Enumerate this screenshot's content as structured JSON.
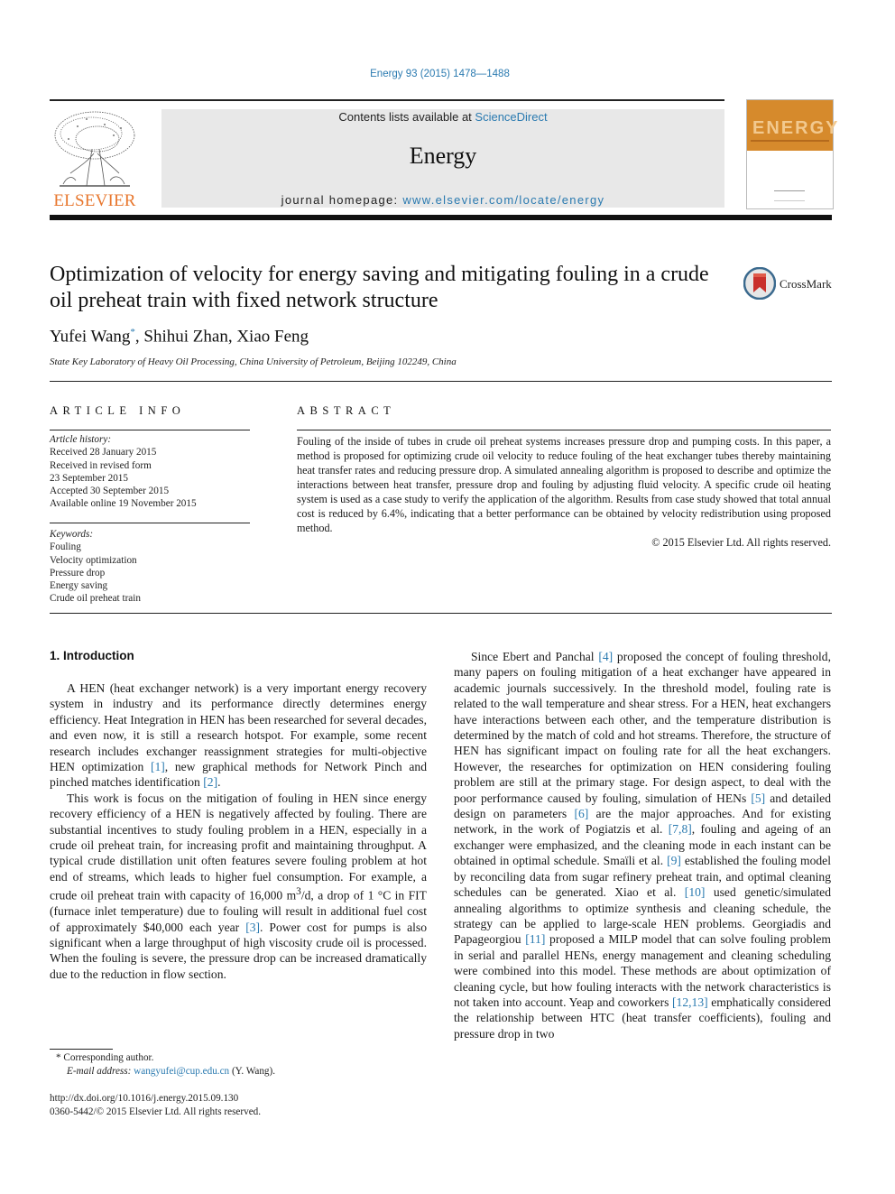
{
  "header": {
    "citation": "Energy 93 (2015) 1478—1488",
    "contents_prefix": "Contents lists available at ",
    "contents_link": "ScienceDirect",
    "journal_name": "Energy",
    "homepage_prefix": "journal homepage: ",
    "homepage_link": "www.elsevier.com/locate/energy",
    "publisher_logo_text": "ELSEVIER",
    "cover_title": "ENERGY"
  },
  "article": {
    "title": "Optimization of velocity for energy saving and mitigating fouling in a crude oil preheat train with fixed network structure",
    "crossmark_label": "CrossMark",
    "authors": [
      {
        "name": "Yufei Wang",
        "mark": "*"
      },
      {
        "name": "Shihui Zhan"
      },
      {
        "name": "Xiao Feng"
      }
    ],
    "author_sep": ", ",
    "affiliation": "State Key Laboratory of Heavy Oil Processing, China University of Petroleum, Beijing 102249, China"
  },
  "article_info": {
    "heading": "ARTICLE INFO",
    "history_label": "Article history:",
    "history": [
      "Received 28 January 2015",
      "Received in revised form",
      "23 September 2015",
      "Accepted 30 September 2015",
      "Available online 19 November 2015"
    ],
    "keywords_label": "Keywords:",
    "keywords": [
      "Fouling",
      "Velocity optimization",
      "Pressure drop",
      "Energy saving",
      "Crude oil preheat train"
    ]
  },
  "abstract": {
    "heading": "ABSTRACT",
    "text": "Fouling of the inside of tubes in crude oil preheat systems increases pressure drop and pumping costs. In this paper, a method is proposed for optimizing crude oil velocity to reduce fouling of the heat exchanger tubes thereby maintaining heat transfer rates and reducing pressure drop. A simulated annealing algorithm is proposed to describe and optimize the interactions between heat transfer, pressure drop and fouling by adjusting fluid velocity. A specific crude oil heating system is used as a case study to verify the application of the algorithm. Results from case study showed that total annual cost is reduced by 6.4%, indicating that a better performance can be obtained by velocity redistribution using proposed method.",
    "copyright": "© 2015 Elsevier Ltd. All rights reserved."
  },
  "intro": {
    "heading": "1.  Introduction",
    "p1": [
      {
        "t": "A HEN (heat exchanger network) is a very important energy recovery system in industry and its performance directly determines energy efficiency. Heat Integration in HEN has been researched for several decades, and even now, it is still a research hotspot. For example, some recent research includes exchanger reassignment strategies for multi-objective HEN optimization "
      },
      {
        "ref": "[1]"
      },
      {
        "t": ", new graphical methods for Network Pinch and pinched matches identification "
      },
      {
        "ref": "[2]"
      },
      {
        "t": "."
      }
    ],
    "p2": [
      {
        "t": "This work is focus on the mitigation of fouling in HEN since energy recovery efficiency of a HEN is negatively affected by fouling. There are substantial incentives to study fouling problem in a HEN, especially in a crude oil preheat train, for increasing profit and maintaining throughput. A typical crude distillation unit often features severe fouling problem at hot end of streams, which leads to higher fuel consumption. For example, a crude oil preheat train with capacity of 16,000 m"
      },
      {
        "sup": "3"
      },
      {
        "t": "/d, a drop of 1 °C in FIT (furnace inlet temperature) due to fouling will result in additional fuel cost of approximately $40,000 each year "
      },
      {
        "ref": "[3]"
      },
      {
        "t": ". Power cost for pumps is also significant when a large throughput of high viscosity crude oil is processed. When the fouling is severe, the pressure drop can be increased dramatically due to the reduction in flow section."
      }
    ],
    "p3": [
      {
        "t": "Since Ebert and Panchal "
      },
      {
        "ref": "[4]"
      },
      {
        "t": " proposed the concept of fouling threshold, many papers on fouling mitigation of a heat exchanger have appeared in academic journals successively. In the threshold model, fouling rate is related to the wall temperature and shear stress. For a HEN, heat exchangers have interactions between each other, and the temperature distribution is determined by the match of cold and hot streams. Therefore, the structure of HEN has significant impact on fouling rate for all the heat exchangers. However, the researches for optimization on HEN considering fouling problem are still at the primary stage. For design aspect, to deal with the poor performance caused by fouling, simulation of HENs "
      },
      {
        "ref": "[5]"
      },
      {
        "t": " and detailed design on parameters "
      },
      {
        "ref": "[6]"
      },
      {
        "t": " are the major approaches. And for existing network, in the work of Pogiatzis et al. "
      },
      {
        "ref": "[7,8]"
      },
      {
        "t": ", fouling and ageing of an exchanger were emphasized, and the cleaning mode in each instant can be obtained in optimal schedule. Smaïli et al. "
      },
      {
        "ref": "[9]"
      },
      {
        "t": " established the fouling model by reconciling data from sugar refinery preheat train, and optimal cleaning schedules can be generated. Xiao et al. "
      },
      {
        "ref": "[10]"
      },
      {
        "t": " used genetic/simulated annealing algorithms to optimize synthesis and cleaning schedule, the strategy can be applied to large-scale HEN problems. Georgiadis and Papageorgiou "
      },
      {
        "ref": "[11]"
      },
      {
        "t": " proposed a MILP model that can solve fouling problem in serial and parallel HENs, energy management and cleaning scheduling were combined into this model. These methods are about optimization of cleaning cycle, but how fouling interacts with the network characteristics is not taken into account. Yeap and coworkers "
      },
      {
        "ref": "[12,13]"
      },
      {
        "t": " emphatically considered the relationship between HTC (heat transfer coefficients), fouling and pressure drop in two"
      }
    ]
  },
  "footnotes": {
    "corresponding": "* Corresponding author.",
    "email_label": "E-mail address: ",
    "email": "wangyufei@cup.edu.cn",
    "email_suffix": " (Y. Wang).",
    "doi": "http://dx.doi.org/10.1016/j.energy.2015.09.130",
    "issn_copyright": "0360-5442/© 2015 Elsevier Ltd. All rights reserved."
  },
  "colors": {
    "link": "#2a7ab0",
    "elsevier_orange": "#e8772e",
    "masthead_gray": "#e8e8e8",
    "cover_orange": "#d68a2c"
  }
}
